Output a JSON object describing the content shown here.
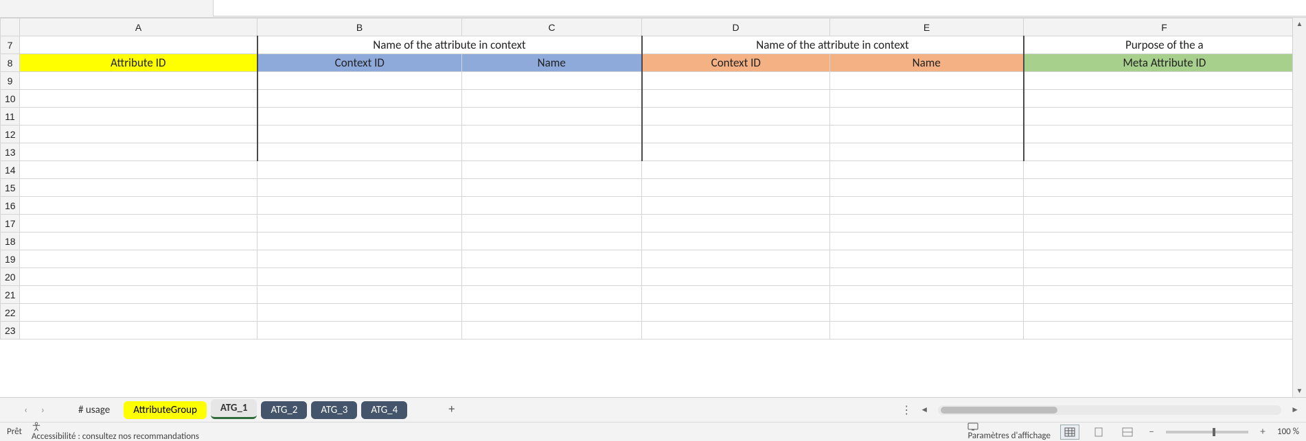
{
  "columns": [
    "A",
    "B",
    "C",
    "D",
    "E",
    "F"
  ],
  "row_start": 7,
  "row_end": 23,
  "row7": {
    "A": "",
    "BC": "Name of the attribute in context",
    "DE": "Name of the attribute in context",
    "F_partial": "Purpose of the a"
  },
  "row8": {
    "A": "Attribute ID",
    "B": "Context ID",
    "C": "Name",
    "D": "Context ID",
    "E": "Name",
    "F": "Meta Attribute ID"
  },
  "tabs": [
    {
      "label": "# usage",
      "style": "plain"
    },
    {
      "label": "AttributeGroup",
      "style": "yellow"
    },
    {
      "label": "ATG_1",
      "style": "gray"
    },
    {
      "label": "ATG_2",
      "style": "dark"
    },
    {
      "label": "ATG_3",
      "style": "dark"
    },
    {
      "label": "ATG_4",
      "style": "dark"
    }
  ],
  "status": {
    "ready": "Prêt",
    "accessibility": "Accessibilité : consultez nos recommandations",
    "display_settings": "Paramètres d'affichage",
    "zoom": "100 %"
  },
  "chart_data": {
    "type": "table",
    "title": "",
    "columns": [
      "Attribute ID",
      "Context ID",
      "Name",
      "Context ID",
      "Name",
      "Meta Attribute ID"
    ],
    "column_groups": [
      {
        "span": [
          0,
          0
        ],
        "header": ""
      },
      {
        "span": [
          1,
          2
        ],
        "header": "Name of the attribute in context"
      },
      {
        "span": [
          3,
          4
        ],
        "header": "Name of the attribute in context"
      },
      {
        "span": [
          5,
          5
        ],
        "header": "Purpose of the a"
      }
    ],
    "rows": [
      [
        "",
        "",
        "",
        "",
        "",
        ""
      ],
      [
        "",
        "",
        "",
        "",
        "",
        ""
      ],
      [
        "",
        "",
        "",
        "",
        "",
        ""
      ],
      [
        "",
        "",
        "",
        "",
        "",
        ""
      ],
      [
        "",
        "",
        "",
        "",
        "",
        ""
      ]
    ]
  }
}
